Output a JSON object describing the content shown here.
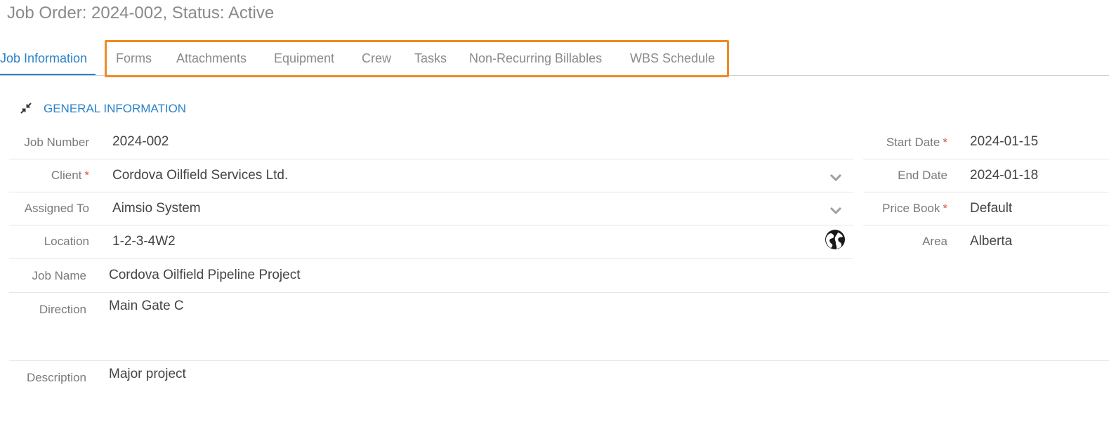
{
  "header": {
    "title": "Job Order: 2024-002, Status: Active"
  },
  "tabs": [
    {
      "label": "Job Information"
    },
    {
      "label": "Forms"
    },
    {
      "label": "Attachments"
    },
    {
      "label": "Equipment"
    },
    {
      "label": "Crew"
    },
    {
      "label": "Tasks"
    },
    {
      "label": "Non-Recurring Billables"
    },
    {
      "label": "WBS Schedule"
    }
  ],
  "section": {
    "title": "GENERAL INFORMATION",
    "icon": "collapse-icon"
  },
  "fields": {
    "job_number": {
      "label": "Job Number",
      "value": "2024-002"
    },
    "client": {
      "label": "Client",
      "required": "*",
      "value": "Cordova Oilfield Services Ltd."
    },
    "assigned_to": {
      "label": "Assigned To",
      "value": "Aimsio System"
    },
    "location": {
      "label": "Location",
      "value": "1-2-3-4W2"
    },
    "job_name": {
      "label": "Job Name",
      "value": "Cordova Oilfield Pipeline Project"
    },
    "direction": {
      "label": "Direction",
      "value": "Main Gate C"
    },
    "description": {
      "label": "Description",
      "value": "Major project"
    },
    "start_date": {
      "label": "Start Date",
      "required": "*",
      "value": "2024-01-15"
    },
    "end_date": {
      "label": "End Date",
      "value": "2024-01-18"
    },
    "price_book": {
      "label": "Price Book",
      "required": "*",
      "value": "Default"
    },
    "area": {
      "label": "Area",
      "value": "Alberta"
    }
  },
  "colors": {
    "accent": "#2b82c9",
    "highlight": "#f08a24",
    "required": "#d9534f"
  }
}
